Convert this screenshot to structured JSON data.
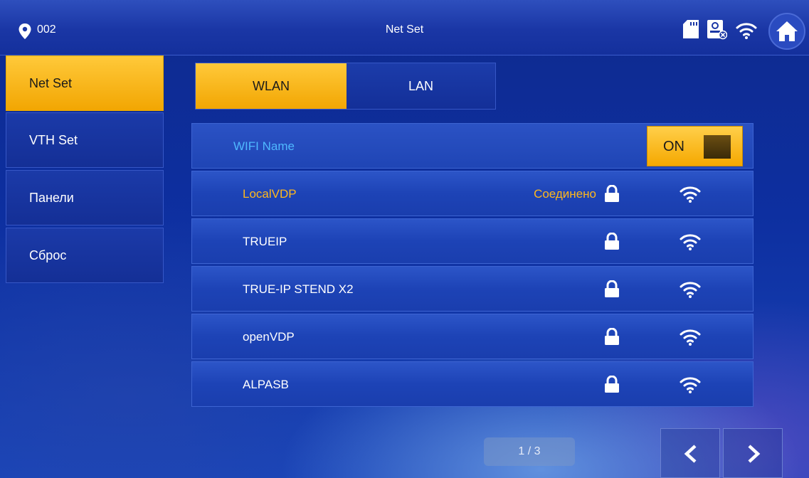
{
  "header": {
    "location_label": "002",
    "title": "Net Set",
    "icons": [
      "location-icon",
      "sd-card-icon",
      "camera-icon",
      "wifi-icon",
      "home-icon"
    ]
  },
  "sidebar": {
    "items": [
      {
        "label": "Net Set",
        "active": true
      },
      {
        "label": "VTH Set",
        "active": false
      },
      {
        "label": "Панели",
        "active": false
      },
      {
        "label": "Сброс",
        "active": false
      }
    ]
  },
  "tabs": [
    {
      "label": "WLAN",
      "active": true
    },
    {
      "label": "LAN",
      "active": false
    }
  ],
  "wifi": {
    "header_label": "WIFI Name",
    "toggle_label": "ON",
    "networks": [
      {
        "name": "LocalVDP",
        "status": "Соединено",
        "locked": true,
        "connected": true
      },
      {
        "name": "TRUEIP",
        "status": "",
        "locked": true,
        "connected": false
      },
      {
        "name": "TRUE-IP STEND X2",
        "status": "",
        "locked": true,
        "connected": false
      },
      {
        "name": "openVDP",
        "status": "",
        "locked": true,
        "connected": false
      },
      {
        "name": "ALPASB",
        "status": "",
        "locked": true,
        "connected": false
      }
    ]
  },
  "pagination": {
    "label": "1 / 3"
  },
  "colors": {
    "accent": "#f5a800",
    "connected_text": "#ffb81c",
    "header_text": "#4fb8ff",
    "panel_blue": "#1d43b6"
  }
}
